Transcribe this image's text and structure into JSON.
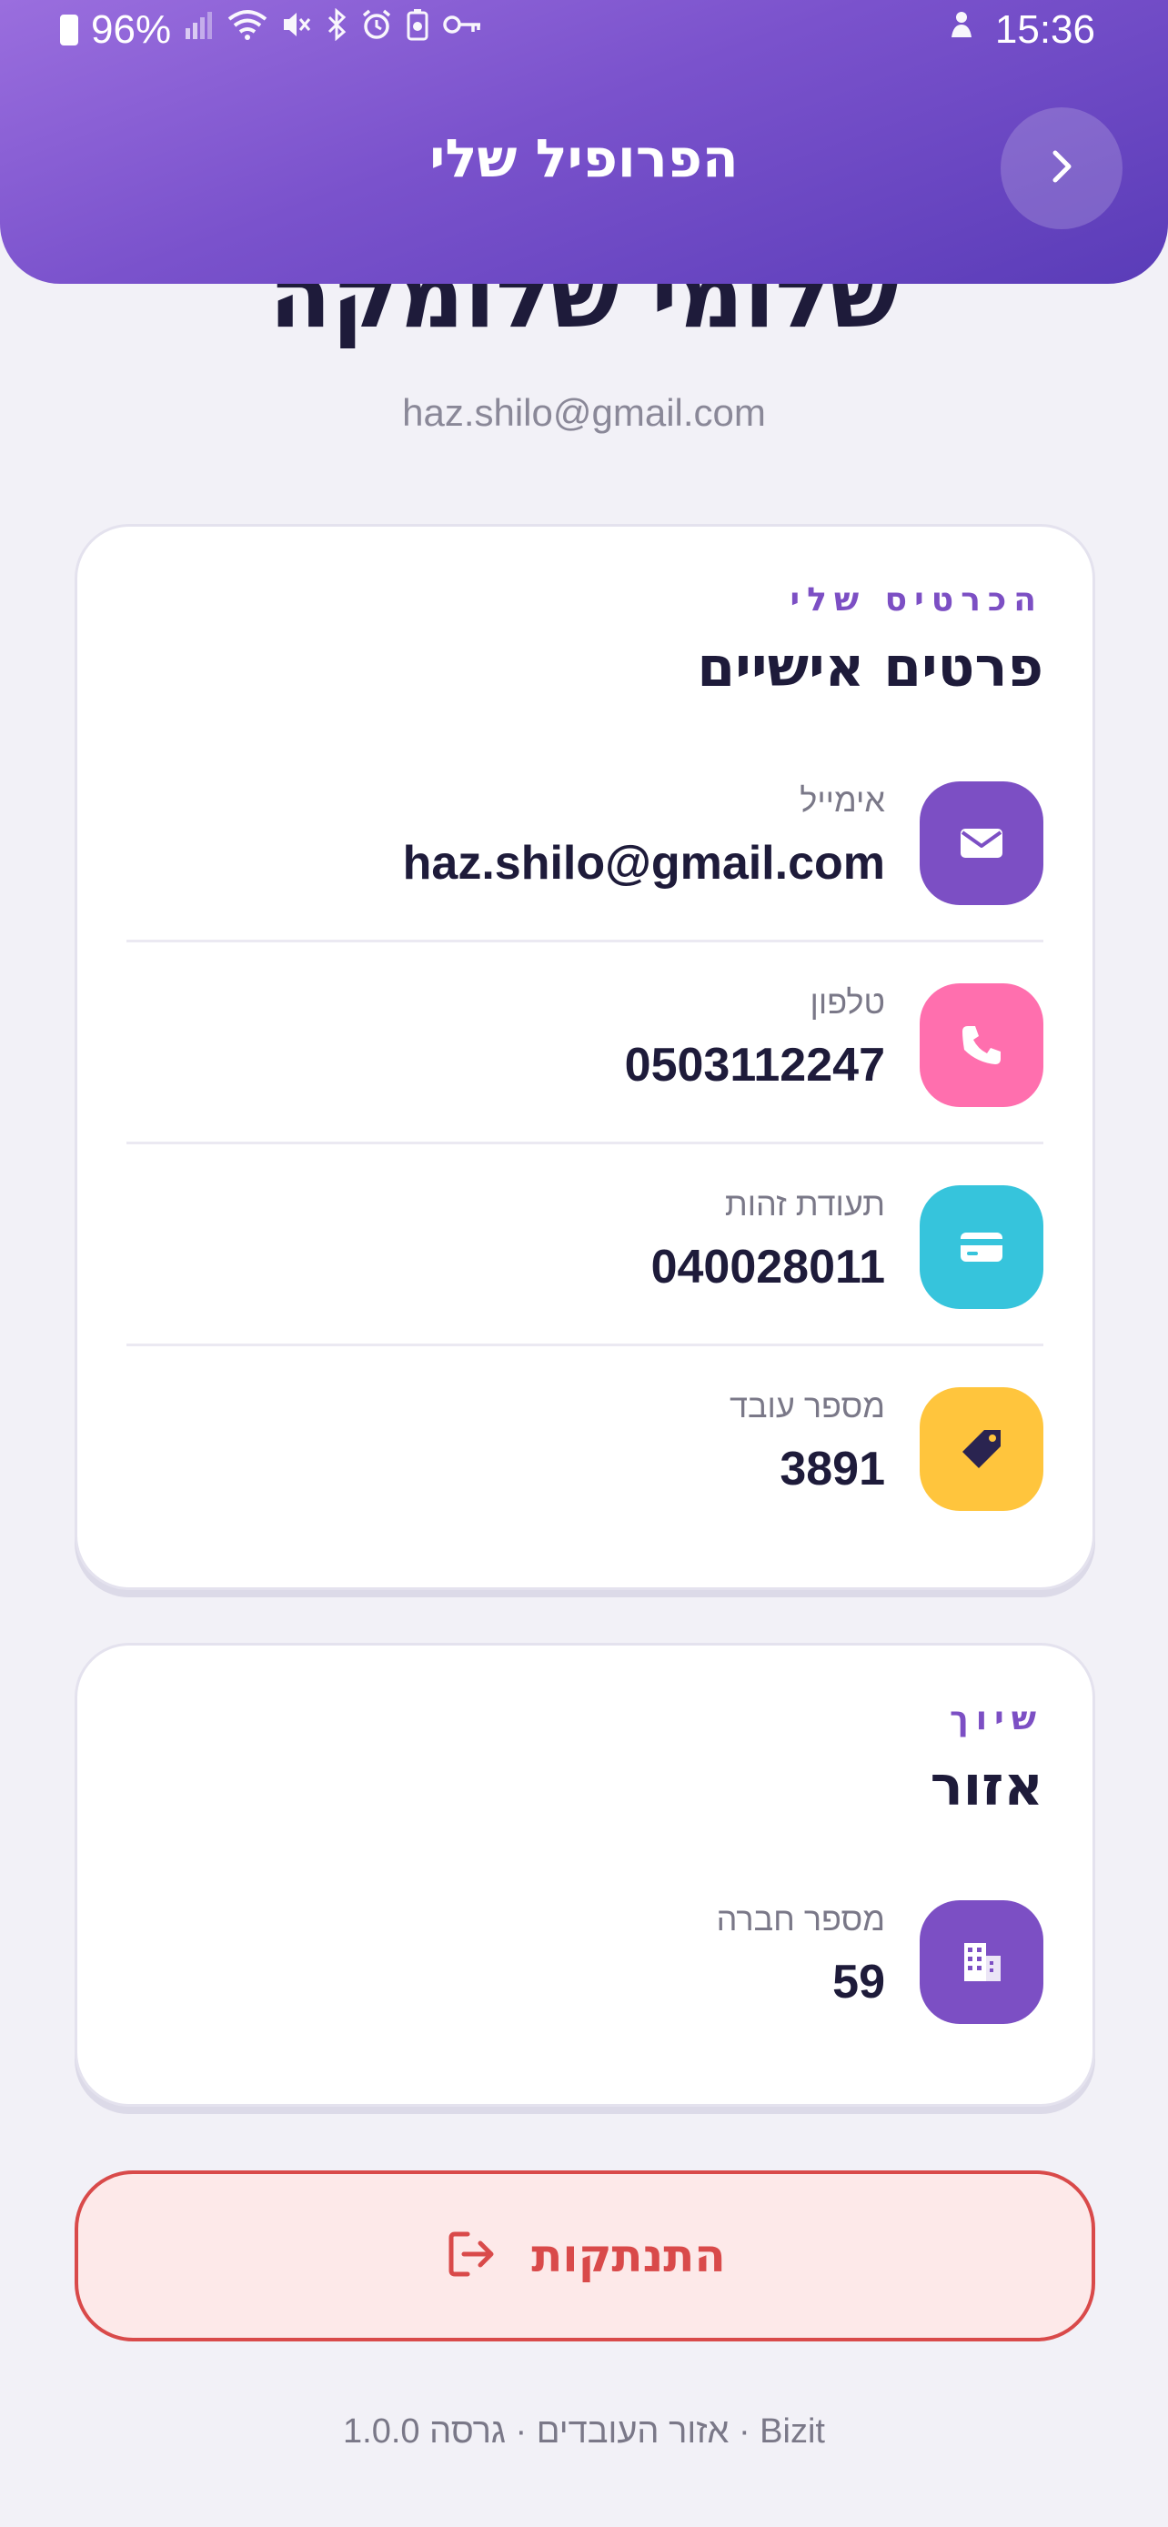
{
  "status_bar": {
    "battery": "96%",
    "time": "15:36"
  },
  "header": {
    "title": "הפרופיל שלי"
  },
  "profile": {
    "name": "שלומי שלומקה",
    "email": "haz.shilo@gmail.com"
  },
  "personal_card": {
    "eyebrow": "הכרטיס שלי",
    "title": "פרטים אישיים",
    "rows": [
      {
        "label": "אימייל",
        "value": "haz.shilo@gmail.com",
        "icon": "mail-icon",
        "color": "#7c4fc4"
      },
      {
        "label": "טלפון",
        "value": "0503112247",
        "icon": "phone-icon",
        "color": "#ff6fae"
      },
      {
        "label": "תעודת זהות",
        "value": "040028011",
        "icon": "id-card-icon",
        "color": "#36c4dc"
      },
      {
        "label": "מספר עובד",
        "value": "3891",
        "icon": "tag-icon",
        "color": "#ffc53d"
      }
    ]
  },
  "affiliation_card": {
    "eyebrow": "שיוך",
    "title": "אזור",
    "rows": [
      {
        "label": "מספר חברה",
        "value": "59",
        "icon": "building-icon",
        "color": "#7c4fc4"
      }
    ]
  },
  "logout": {
    "label": "התנתקות"
  },
  "footer": {
    "text": "אזור העובדים · גרסה 1.0.0 · Bizit"
  }
}
